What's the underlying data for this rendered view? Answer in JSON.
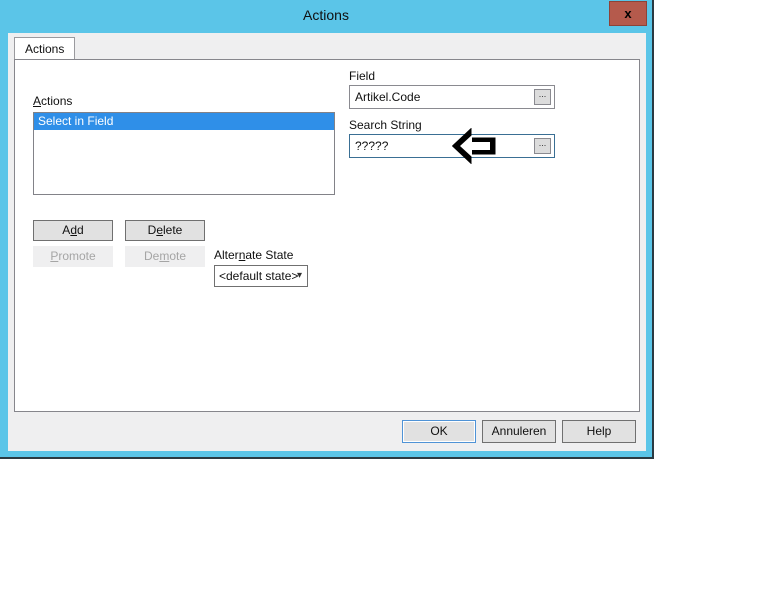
{
  "window": {
    "title": "Actions",
    "close_label": "x",
    "titlebar_color": "#5bc5e8",
    "close_button_color": "#b55a4c",
    "client_bg": "#efeff0"
  },
  "tabs": [
    {
      "label": "Actions",
      "selected": true
    }
  ],
  "left_panel": {
    "actions_label": "Actions",
    "actions_mnemonic": "A",
    "list_items": [
      {
        "label": "Select in Field",
        "selected": true
      }
    ],
    "buttons": [
      {
        "label": "Add",
        "mnemonic": "d",
        "enabled": true
      },
      {
        "label": "Delete",
        "mnemonic": "e",
        "enabled": true
      },
      {
        "label": "Promote",
        "mnemonic": "P",
        "enabled": false
      },
      {
        "label": "Demote",
        "mnemonic": "m",
        "enabled": false
      }
    ],
    "alternate_state": {
      "label": "Alternate State",
      "mnemonic": "m",
      "value": "<default state>",
      "arrow_icon": "chevron-down-icon"
    }
  },
  "right_panel": {
    "field": {
      "label": "Field",
      "value": "Artikel.Code",
      "browse_label": "...",
      "focused": false
    },
    "search_string": {
      "label": "Search String",
      "value": "?????",
      "browse_label": "...",
      "focused": true
    }
  },
  "annotation": {
    "arrow_icon": "left-arrow-annotation",
    "color": "#000000",
    "points_to": "search-string-field"
  },
  "footer": {
    "buttons": [
      {
        "label": "OK",
        "default": true
      },
      {
        "label": "Annuleren",
        "default": false
      },
      {
        "label": "Help",
        "default": false
      }
    ]
  }
}
